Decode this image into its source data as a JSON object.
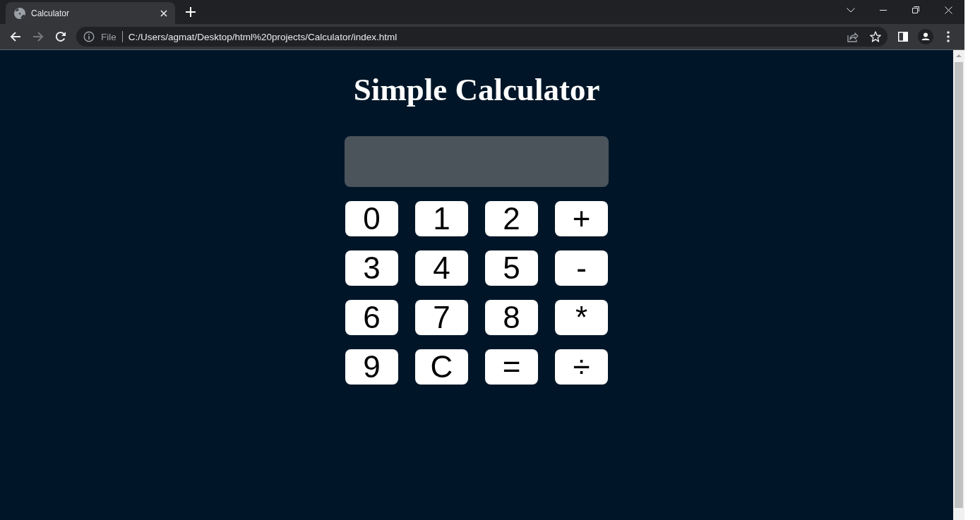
{
  "browser": {
    "tabs": [
      {
        "title": "Calculator",
        "selected": true
      }
    ],
    "nav_buttons": [
      {
        "kind": "back",
        "disabled": false
      },
      {
        "kind": "forward",
        "disabled": true
      },
      {
        "kind": "reload",
        "disabled": false
      }
    ],
    "address_bar": {
      "scheme_label": "File",
      "url": "C:/Users/agmat/Desktop/html%20projects/Calculator/index.html"
    }
  },
  "page": {
    "heading": "Simple Calculator",
    "keys": [
      "0",
      "1",
      "2",
      "+",
      "3",
      "4",
      "5",
      "-",
      "6",
      "7",
      "8",
      "*",
      "9",
      "C",
      "=",
      "÷"
    ]
  }
}
